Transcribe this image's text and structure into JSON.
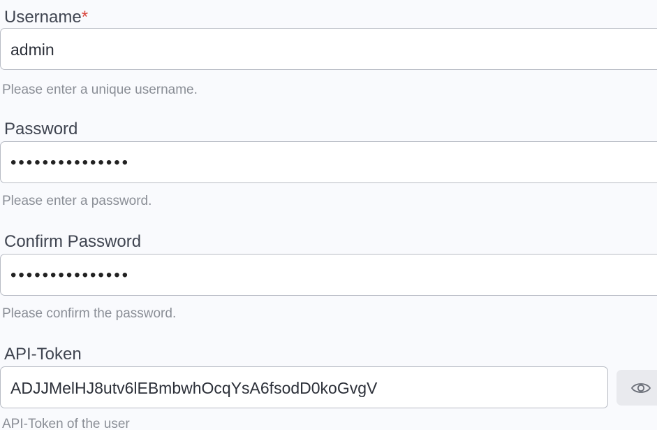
{
  "username": {
    "label": "Username",
    "required_mark": "*",
    "value": "admin",
    "help": "Please enter a unique username."
  },
  "password": {
    "label": "Password",
    "value": "•••••••••••••••",
    "help": "Please enter a password."
  },
  "confirm_password": {
    "label": "Confirm Password",
    "value": "•••••••••••••••",
    "help": "Please confirm the password."
  },
  "api_token": {
    "label": "API-Token",
    "value": "ADJJMelHJ8utv6lEBmbwhOcqYsA6fsodD0koGvgV",
    "help": "API-Token of the user",
    "toggle_icon": "eye-icon"
  },
  "colors": {
    "background": "#f9fafd",
    "required": "#d9443c",
    "border": "#b7bbc4",
    "help_text": "#8a8e96"
  }
}
